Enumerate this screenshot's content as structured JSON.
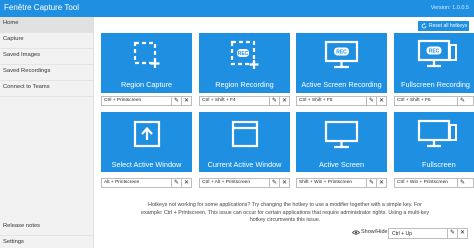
{
  "window": {
    "title": "Fenêtre Capture Tool",
    "version": "Version: 1.0.0.5"
  },
  "sidebar": {
    "items": [
      {
        "label": "Home"
      },
      {
        "label": "Capture"
      },
      {
        "label": "Saved Images"
      },
      {
        "label": "Saved Recordings"
      },
      {
        "label": "Connect to Teams"
      }
    ],
    "bottom_items": [
      {
        "label": "Release notes"
      },
      {
        "label": "Settings"
      }
    ]
  },
  "toolbar": {
    "reset_label": "Reset all hotkeys"
  },
  "tiles": [
    {
      "label": "Region Capture",
      "hotkey": "Ctrl + Printscreen",
      "icon": "region-capture-icon"
    },
    {
      "label": "Region Recording",
      "hotkey": "Ctrl + Shift + F4",
      "icon": "region-recording-icon"
    },
    {
      "label": "Active Screen Recording",
      "hotkey": "Ctrl + Shift + F5",
      "icon": "screen-recording-icon"
    },
    {
      "label": "Fullscreen Recording",
      "hotkey": "Ctrl + Shift + F6",
      "icon": "fullscreen-recording-icon"
    },
    {
      "label": "Select Active Window",
      "hotkey": "Alt + Printscreen",
      "icon": "select-window-icon"
    },
    {
      "label": "Current Active Window",
      "hotkey": "Ctrl + Alt + Printscreen",
      "icon": "window-icon"
    },
    {
      "label": "Active Screen",
      "hotkey": "Shift + Win + Printscreen",
      "icon": "monitor-icon"
    },
    {
      "label": "Fullscreen",
      "hotkey": "Ctrl + Win + Printscreen",
      "icon": "monitor-icon"
    }
  ],
  "notice": {
    "line1": "Hotkeys not working for some applications? Try changing the hotkey to use a modifier together with a simple key. For",
    "line2": "example: Ctrl + Printscreen. This issue can occur for certain applications that require administrator rights. Using a multi-key",
    "line3": "hotkey circumvents this issue."
  },
  "show_hide": {
    "label": "Show/Hide:",
    "value": "Ctrl + Up"
  },
  "colors": {
    "accent": "#1e8fe1",
    "title_bar": "#1e8fe1"
  },
  "icons": {
    "edit": "pencil-icon",
    "clear": "x-icon",
    "reset": "reset-icon",
    "eye": "eye-icon"
  }
}
